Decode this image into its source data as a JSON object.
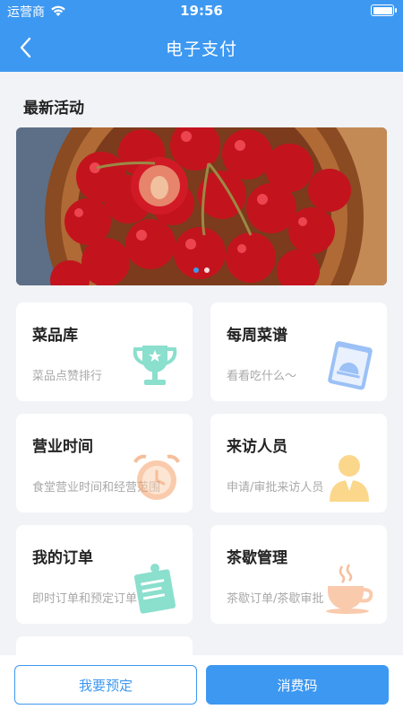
{
  "status_bar": {
    "carrier": "运营商",
    "time": "19:56"
  },
  "nav": {
    "title": "电子支付"
  },
  "section": {
    "title": "最新活动"
  },
  "banner": {
    "image": "cherries-in-wooden-bowl",
    "slide_count": 2,
    "active_slide": 1
  },
  "cards": [
    {
      "title": "菜品库",
      "subtitle": "菜品点赞排行",
      "icon": "trophy-icon"
    },
    {
      "title": "每周菜谱",
      "subtitle": "看看吃什么～",
      "icon": "menu-book-icon"
    },
    {
      "title": "营业时间",
      "subtitle": "食堂营业时间和经营范围",
      "icon": "alarm-clock-icon"
    },
    {
      "title": "来访人员",
      "subtitle": "申请/审批来访人员",
      "icon": "visitor-icon"
    },
    {
      "title": "我的订单",
      "subtitle": "即时订单和预定订单",
      "icon": "notepad-icon"
    },
    {
      "title": "茶歇管理",
      "subtitle": "茶歇订单/茶歇审批",
      "icon": "tea-cup-icon"
    }
  ],
  "buttons": {
    "reserve": "我要预定",
    "consume_code": "消费码"
  },
  "colors": {
    "primary": "#3d98f1",
    "background": "#f2f3f7"
  }
}
